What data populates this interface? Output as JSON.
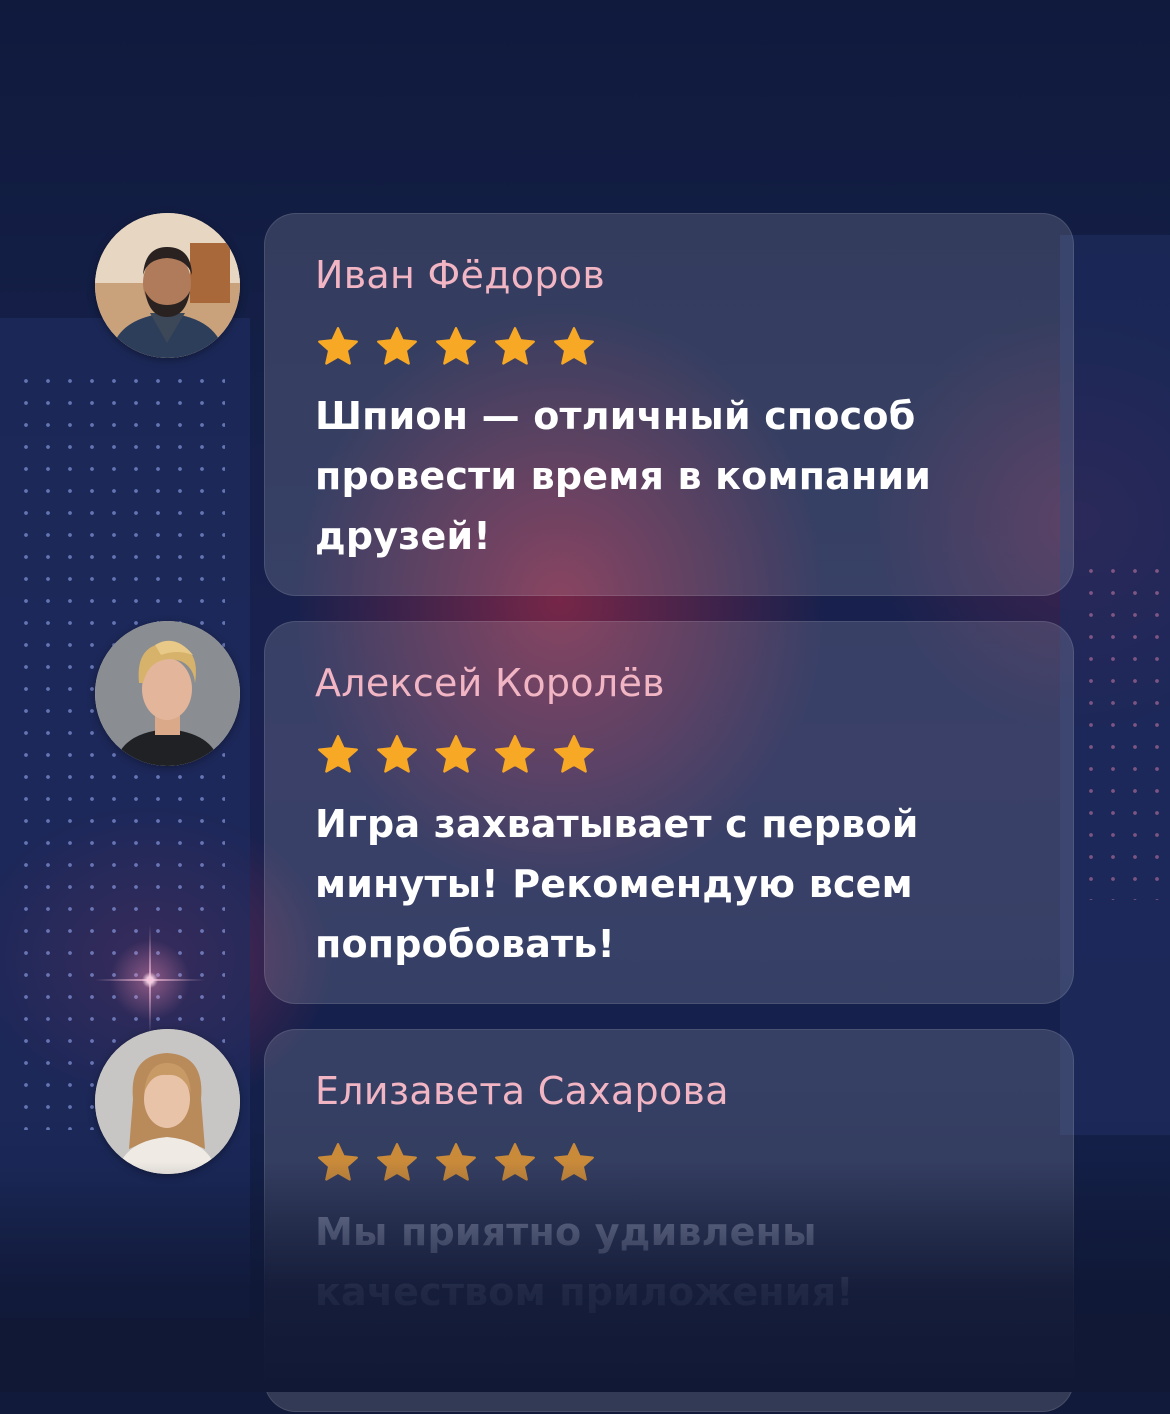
{
  "reviews": [
    {
      "name": "Иван Фёдоров",
      "rating": 5,
      "text_lines": [
        "Шпион — отличный способ",
        "провести время в компании",
        "друзей!"
      ],
      "avatar": "male-bearded-photo"
    },
    {
      "name": "Алексей Королёв",
      "rating": 5,
      "text_lines": [
        "Игра захватывает с первой",
        "минуты! Рекомендую всем",
        "попробовать!"
      ],
      "avatar": "male-blond-photo"
    },
    {
      "name": "Елизавета Сахарова",
      "rating": 5,
      "text_lines": [
        "Мы приятно удивлены",
        "качеством приложения!"
      ],
      "avatar": "female-smiling-photo"
    }
  ],
  "colors": {
    "name": "#f2b5c4",
    "star": "#f7a825",
    "text": "#ffffff",
    "background": "#111a3a"
  },
  "icons": [
    "star-icon"
  ]
}
